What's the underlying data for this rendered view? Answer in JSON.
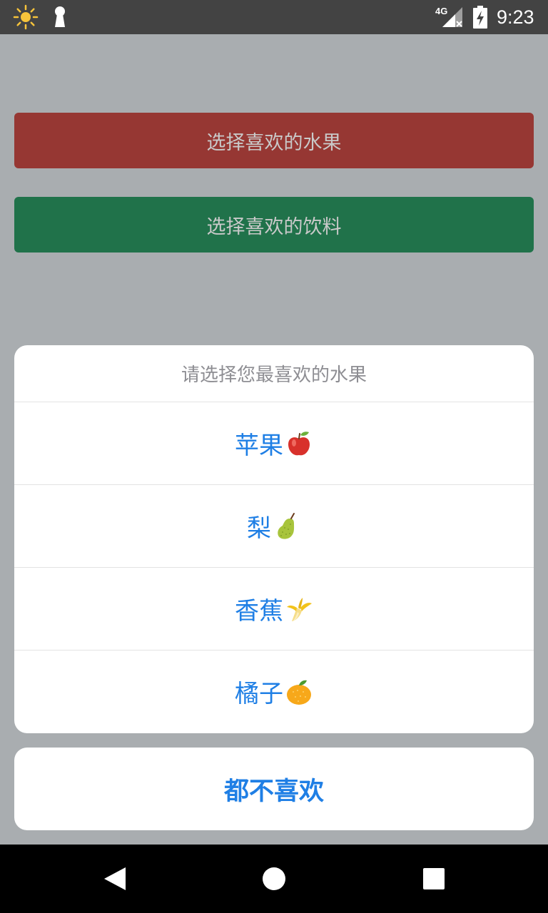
{
  "status_bar": {
    "network": "4G",
    "time": "9:23"
  },
  "buttons": {
    "fruit": "选择喜欢的水果",
    "drink": "选择喜欢的饮料"
  },
  "action_sheet": {
    "title": "请选择您最喜欢的水果",
    "options": [
      {
        "label": "苹果",
        "icon": "apple-icon"
      },
      {
        "label": "梨",
        "icon": "pear-icon"
      },
      {
        "label": "香蕉",
        "icon": "banana-icon"
      },
      {
        "label": "橘子",
        "icon": "tangerine-icon"
      }
    ],
    "cancel": "都不喜欢"
  },
  "colors": {
    "fruit_button": "#963733",
    "drink_button": "#20724a",
    "option_text": "#1f7fe5",
    "backdrop": "#a9adb0"
  }
}
